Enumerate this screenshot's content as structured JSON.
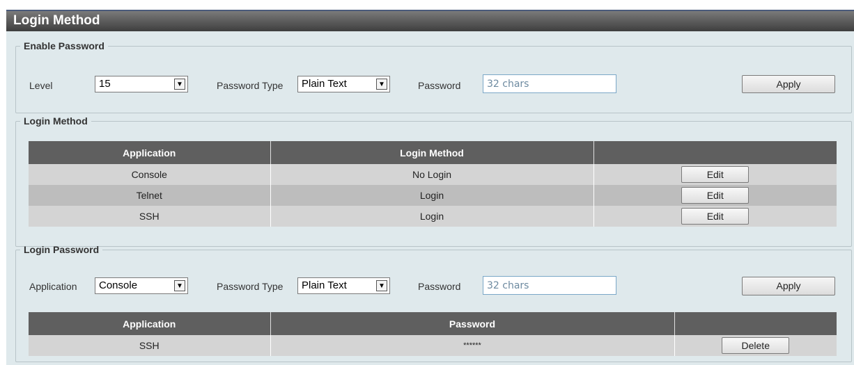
{
  "page": {
    "title": "Login Method"
  },
  "enable_password": {
    "legend": "Enable Password",
    "level_label": "Level",
    "level_value": "15",
    "password_type_label": "Password Type",
    "password_type_value": "Plain Text",
    "password_label": "Password",
    "password_placeholder": "32 chars",
    "apply_label": "Apply"
  },
  "login_method": {
    "legend": "Login Method",
    "columns": [
      "Application",
      "Login Method",
      ""
    ],
    "rows": [
      {
        "application": "Console",
        "method": "No Login",
        "action": "Edit"
      },
      {
        "application": "Telnet",
        "method": "Login",
        "action": "Edit"
      },
      {
        "application": "SSH",
        "method": "Login",
        "action": "Edit"
      }
    ]
  },
  "login_password": {
    "legend": "Login Password",
    "application_label": "Application",
    "application_value": "Console",
    "password_type_label": "Password Type",
    "password_type_value": "Plain Text",
    "password_label": "Password",
    "password_placeholder": "32 chars",
    "apply_label": "Apply",
    "columns": [
      "Application",
      "Password",
      ""
    ],
    "rows": [
      {
        "application": "SSH",
        "password": "******",
        "action": "Delete"
      }
    ]
  },
  "icons": {
    "dropdown": "chevron-down-icon"
  }
}
